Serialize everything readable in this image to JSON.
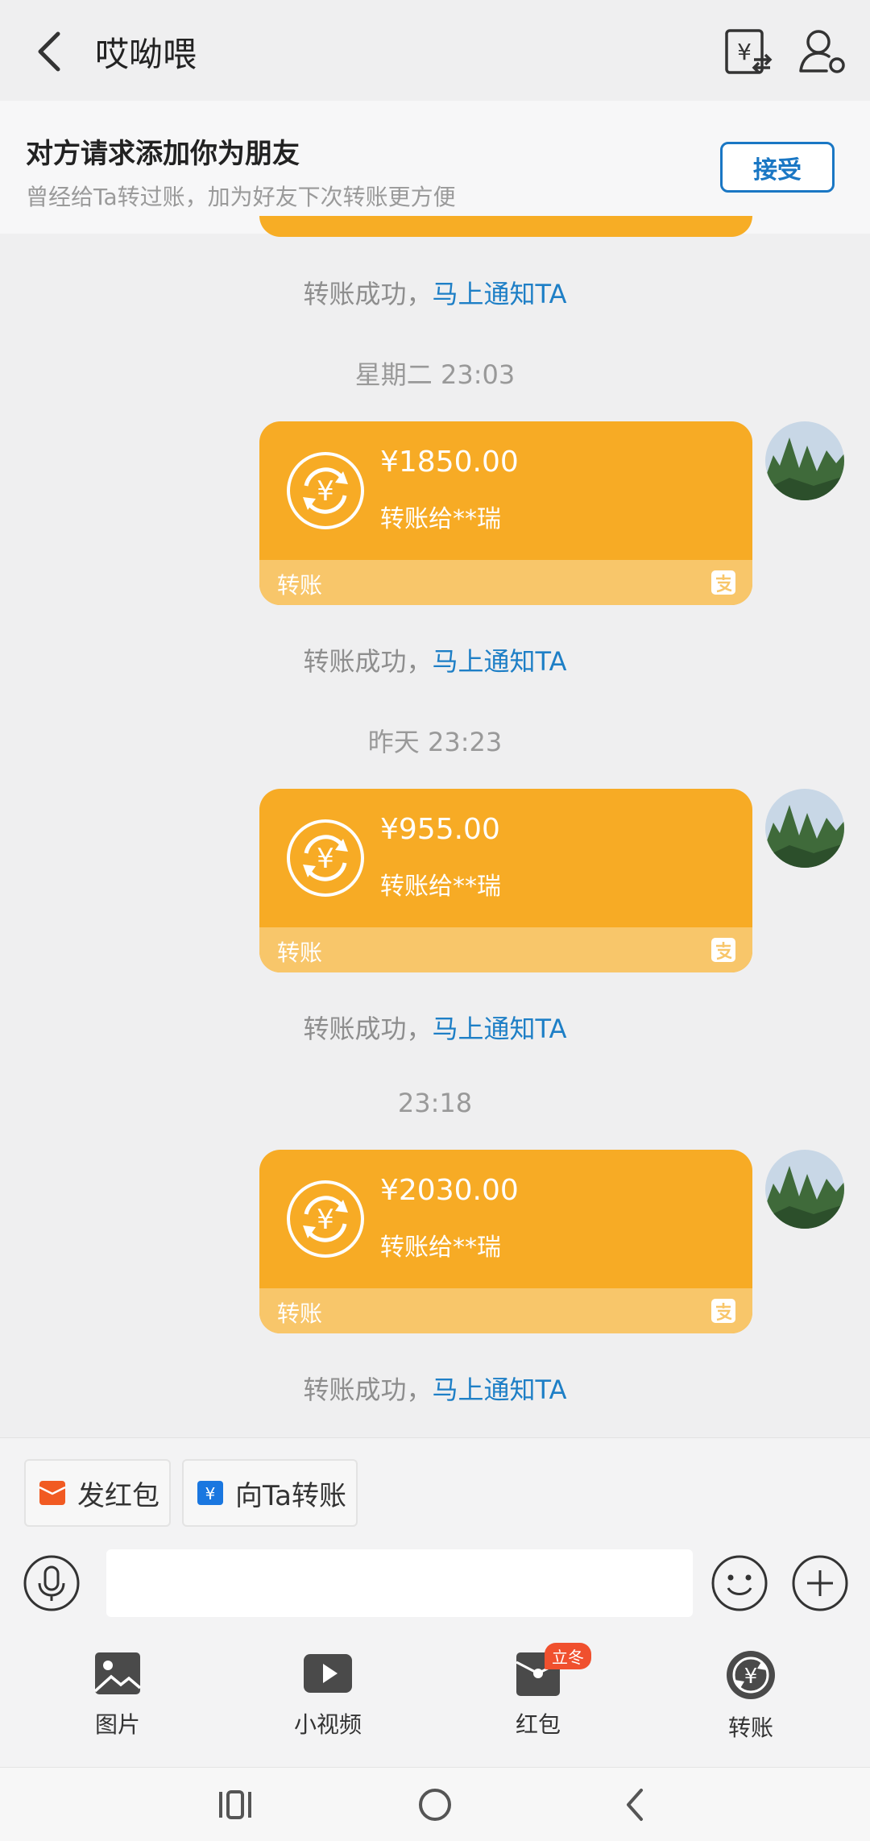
{
  "header": {
    "title": "哎呦喂",
    "icons": [
      "back-icon",
      "transfer-record-icon",
      "person-settings-icon"
    ]
  },
  "banner": {
    "title": "对方请求添加你为朋友",
    "subtitle": "曾经给Ta转过账，加为好友下次转账更方便",
    "accept_label": "接受"
  },
  "messages": {
    "notice_prefix": "转账成功，",
    "notice_link": "马上通知TA",
    "times": [
      "星期二 23:03",
      "昨天 23:23",
      "23:18"
    ],
    "transfers": [
      {
        "amount": "¥1850.00",
        "desc": "转账给**瑞",
        "foot": "转账"
      },
      {
        "amount": "¥955.00",
        "desc": "转账给**瑞",
        "foot": "转账"
      },
      {
        "amount": "¥2030.00",
        "desc": "转账给**瑞",
        "foot": "转账"
      }
    ]
  },
  "quick_actions": {
    "red_packet": "发红包",
    "transfer_to": "向Ta转账"
  },
  "input": {
    "value": "",
    "placeholder": ""
  },
  "tools": [
    {
      "label": "图片",
      "icon": "image-icon"
    },
    {
      "label": "小视频",
      "icon": "video-icon"
    },
    {
      "label": "红包",
      "icon": "red-packet-icon",
      "badge": "立冬"
    },
    {
      "label": "转账",
      "icon": "transfer-icon"
    }
  ],
  "colors": {
    "card": "#f7ab25",
    "card_foot": "#f8c66a",
    "link": "#1e7fc6",
    "accept": "#1a77c4",
    "badge": "#f0502e"
  }
}
